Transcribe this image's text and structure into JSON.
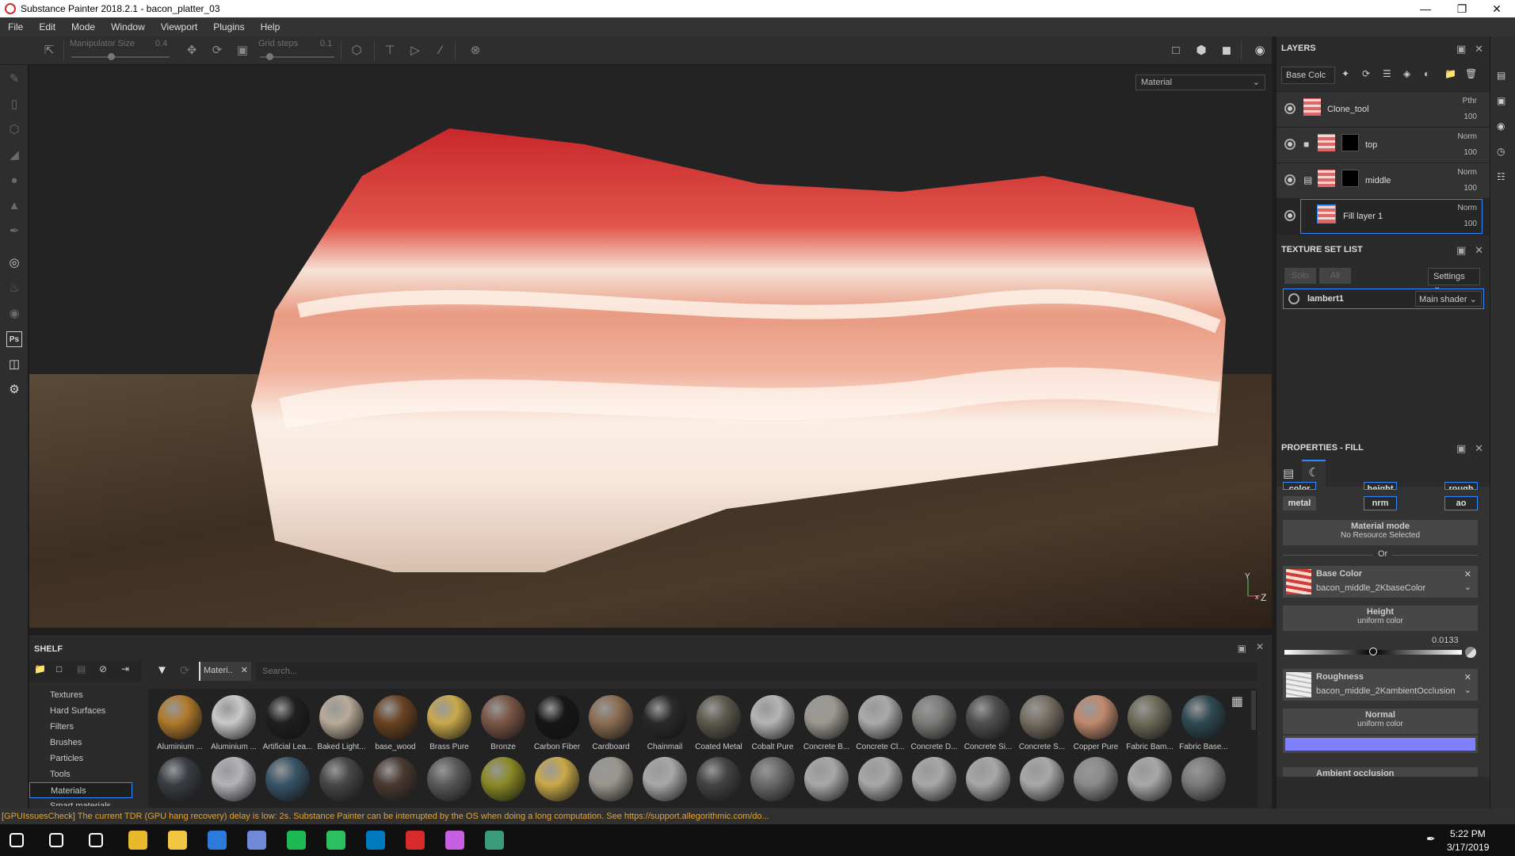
{
  "window": {
    "title": "Substance Painter 2018.2.1 - bacon_platter_03",
    "controls": [
      "minimize",
      "restore",
      "close"
    ]
  },
  "menu": [
    "File",
    "Edit",
    "Mode",
    "Window",
    "Viewport",
    "Plugins",
    "Help"
  ],
  "toolbar": {
    "manipulator_size_label": "Manipulator Size",
    "manipulator_size_value": "0.4",
    "grid_steps_label": "Grid steps",
    "grid_steps_value": "0.1"
  },
  "viewport": {
    "display_mode": "Material",
    "axis_labels": {
      "y": "Y",
      "x": "x",
      "z": "Z"
    }
  },
  "layers": {
    "title": "LAYERS",
    "channel_select": "Base Colc",
    "items": [
      {
        "name": "Clone_tool",
        "blend": "Pthr",
        "opacity": "100",
        "type": "layer"
      },
      {
        "name": "top",
        "blend": "Norm",
        "opacity": "100",
        "type": "folder"
      },
      {
        "name": "middle",
        "blend": "Norm",
        "opacity": "100",
        "type": "folder-open"
      },
      {
        "name": "Fill layer 1",
        "blend": "Norm",
        "opacity": "100",
        "type": "fill",
        "selected": true
      }
    ]
  },
  "texture_set_list": {
    "title": "TEXTURE SET LIST",
    "solo_label": "Solo",
    "all_label": "All",
    "settings_label": "Settings",
    "items": [
      {
        "name": "lambert1",
        "shader": "Main shader"
      }
    ]
  },
  "properties": {
    "title": "PROPERTIES - FILL",
    "channels_row1": [
      "color",
      "height",
      "rough"
    ],
    "channels_row2": [
      "metal",
      "nrm",
      "ao"
    ],
    "material_mode": {
      "title": "Material mode",
      "subtitle": "No Resource Selected"
    },
    "or_label": "Or",
    "base_color": {
      "title": "Base Color",
      "resource": "bacon_middle_2KbaseColor"
    },
    "height": {
      "title": "Height",
      "subtitle": "uniform color",
      "value": "0.0133",
      "slider_fraction": 0.5
    },
    "roughness": {
      "title": "Roughness",
      "resource": "bacon_middle_2KambientOcclusion"
    },
    "normal": {
      "title": "Normal",
      "subtitle": "uniform color",
      "color": "#8080ff"
    },
    "ambient_occlusion": {
      "title": "Ambient occlusion"
    }
  },
  "shelf": {
    "title": "SHELF",
    "filter_tag": "Materi..",
    "search_placeholder": "Search...",
    "categories": [
      "Textures",
      "Hard Surfaces",
      "Filters",
      "Brushes",
      "Particles",
      "Tools",
      "Materials",
      "Smart materials"
    ],
    "selected_category": "Materials",
    "materials_row1": [
      {
        "name": "Aluminium ...",
        "color": "#b07a2a"
      },
      {
        "name": "Aluminium ...",
        "color": "#c9c9c9"
      },
      {
        "name": "Artificial Lea...",
        "color": "#1f1f1f"
      },
      {
        "name": "Baked Light...",
        "color": "#b8ab98"
      },
      {
        "name": "base_wood",
        "color": "#6b4322"
      },
      {
        "name": "Brass Pure",
        "color": "#c9a94a"
      },
      {
        "name": "Bronze",
        "color": "#7a5546"
      },
      {
        "name": "Carbon Fiber",
        "color": "#161616"
      },
      {
        "name": "Cardboard",
        "color": "#8b6d52"
      },
      {
        "name": "Chainmail",
        "color": "#2a2a2a"
      },
      {
        "name": "Coated Metal",
        "color": "#5c5a4c"
      },
      {
        "name": "Cobalt Pure",
        "color": "#b5b5b5"
      },
      {
        "name": "Concrete B...",
        "color": "#9c9890"
      },
      {
        "name": "Concrete Cl...",
        "color": "#a9aaa9"
      },
      {
        "name": "Concrete D...",
        "color": "#7c7c7a"
      },
      {
        "name": "Concrete Si...",
        "color": "#4f4f4f"
      },
      {
        "name": "Concrete S...",
        "color": "#776e62"
      },
      {
        "name": "Copper Pure",
        "color": "#c08a6e"
      },
      {
        "name": "Fabric Bam...",
        "color": "#6c6a58"
      },
      {
        "name": "Fabric Base...",
        "color": "#2f4a52"
      }
    ],
    "materials_row2_colors": [
      "#3a3e44",
      "#b5b2b8",
      "#395468",
      "#474747",
      "#4a3a32",
      "#5a5a5a",
      "#8a8a26",
      "#c9a94a",
      "#9a968e",
      "#a8a8a8",
      "#444444",
      "#6a6a6a",
      "#a8a8a8",
      "#a8a8a8",
      "#a8a8a8",
      "#a8a8a8",
      "#a8a8a8",
      "#8a8a8a",
      "#a8a8a8",
      "#7a7a7a"
    ]
  },
  "status": {
    "message": "[GPUIssuesCheck] The current TDR (GPU hang recovery) delay is low: 2s. Substance Painter can be interrupted by the OS when doing a long computation. See https://support.allegorithmic.com/do..."
  },
  "taskbar": {
    "apps": [
      "windows-start",
      "search",
      "task-view",
      "chrome",
      "file-explorer",
      "krita",
      "discord",
      "spotify",
      "evernote",
      "trello",
      "substance-painter",
      "paint-3d",
      "app"
    ],
    "time": "5:22 PM",
    "date": "3/17/2019"
  }
}
